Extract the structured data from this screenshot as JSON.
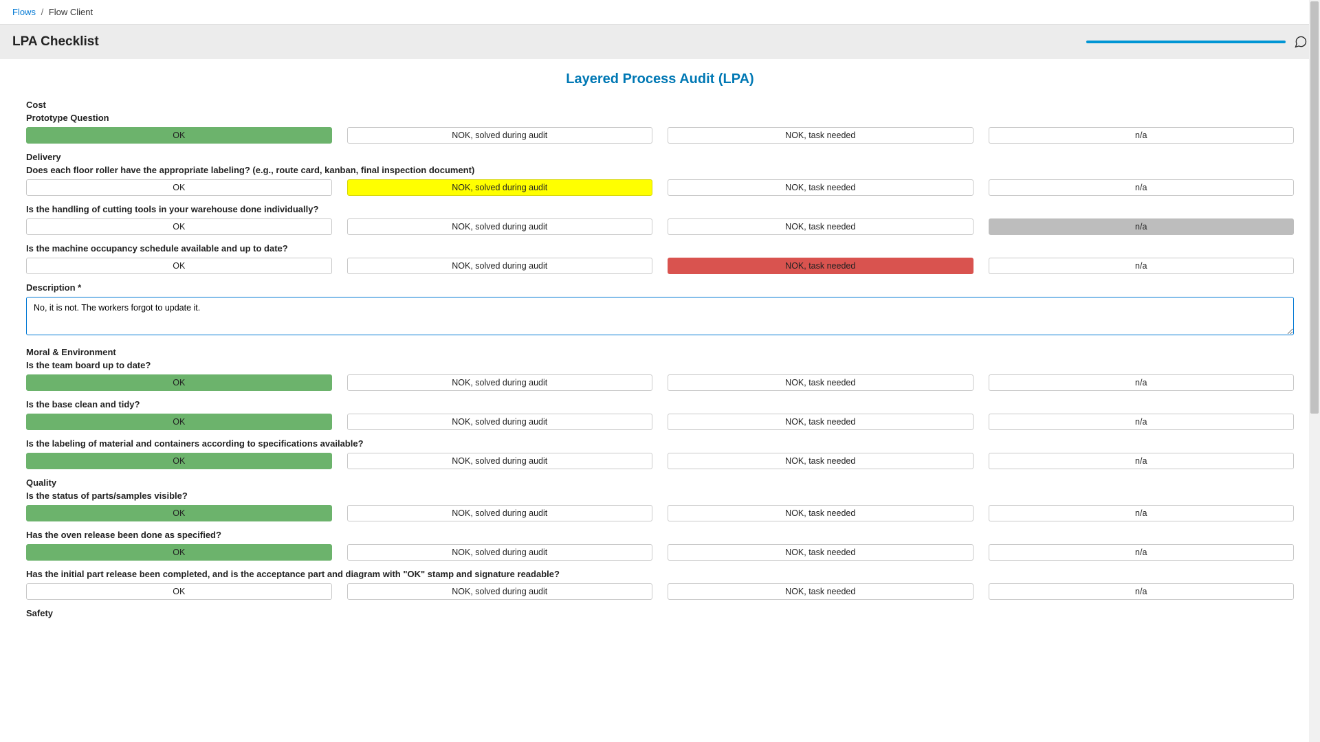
{
  "breadcrumb": {
    "root": "Flows",
    "sep": "/",
    "current": "Flow Client"
  },
  "header": {
    "title": "LPA Checklist"
  },
  "main_title": "Layered Process Audit (LPA)",
  "opt_labels": {
    "ok": "OK",
    "solved": "NOK, solved during audit",
    "task": "NOK, task needed",
    "na": "n/a"
  },
  "description": {
    "label": "Description *",
    "value": "No, it is not. The workers forgot to update it."
  },
  "sections": [
    {
      "title": "Cost",
      "questions": [
        {
          "text": "Prototype Question",
          "selected": "ok"
        }
      ]
    },
    {
      "title": "Delivery",
      "questions": [
        {
          "text": "Does each floor roller have the appropriate labeling? (e.g., route card, kanban, final inspection document)",
          "selected": "solved"
        },
        {
          "text": "Is the handling of cutting tools in your warehouse done individually?",
          "selected": "na"
        },
        {
          "text": "Is the machine occupancy schedule available and up to date?",
          "selected": "task",
          "has_description": true
        }
      ]
    },
    {
      "title": "Moral & Environment",
      "questions": [
        {
          "text": "Is the team board up to date?",
          "selected": "ok"
        },
        {
          "text": "Is the base clean and tidy?",
          "selected": "ok"
        },
        {
          "text": "Is the labeling of material and containers according to specifications available?",
          "selected": "ok"
        }
      ]
    },
    {
      "title": "Quality",
      "questions": [
        {
          "text": "Is the status of parts/samples visible?",
          "selected": "ok"
        },
        {
          "text": "Has the oven release been done as specified?",
          "selected": "ok"
        },
        {
          "text": "Has the initial part release been completed, and is the acceptance part and diagram with \"OK\" stamp and signature readable?",
          "selected": ""
        }
      ]
    },
    {
      "title": "Safety",
      "questions": []
    }
  ]
}
